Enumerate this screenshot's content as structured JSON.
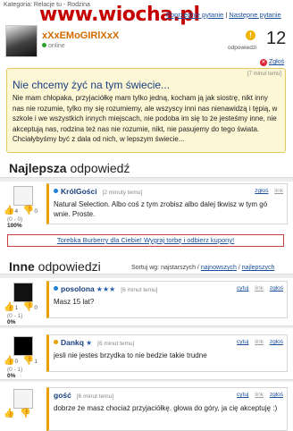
{
  "topbar": {
    "category_text": "Kategoria: Relacje tu - Rodzina",
    "watermark": "www.wiocha.pl",
    "prev_question": "Poprzednie pytanie",
    "separator": "|",
    "next_question": "Następne pytanie"
  },
  "asker": {
    "username": "xXxEMoGIRlXxX",
    "status": "online",
    "answers_count": "12",
    "answers_label": "odpowiedzi",
    "report_label": "Zgłoś"
  },
  "question": {
    "time": "[7 minut temu]",
    "title": "Nie chcemy żyć na tym świecie...",
    "body": "Nie mam chłopaka, przyjaciółkę mam tylko jedną, kocham ją jak siostrę, nikt inny nas nie rozumie, tylko my się rozumiemy, ale wszyscy inni nas nienawidzą i tępią, w szkole i we wszystkich innych miejscach, nie podoba im się to że jesteśmy inne, nie akceptują nas, rodzina też nas nie rozumie, nikt, nie pasujemy do tego świata. Chciałybyśmy być z dala od nich, w lepszym świecie..."
  },
  "best": {
    "title_bold": "Najlepsza",
    "title_rest": "odpowiedź",
    "author": "KrólGości",
    "time": "[2 minuty temu]",
    "report": "zgłoś",
    "link": "link",
    "text": "Natural Selection. Albo coś z tym zrobisz albo dalej tkwisz w tym gó wnie. Proste.",
    "votes_up": "4",
    "votes_down": "0",
    "tally": "(0 - 0)",
    "percent": "100%"
  },
  "ad": {
    "text": "Torebka Burberry dla Ciebie! Wygraj torbę i odbierz kupony!"
  },
  "others": {
    "title_bold": "Inne",
    "title_rest": "odpowiedzi",
    "sort_label": "Sortuj wg: najstarszych /",
    "sort_newest": "najnowszych",
    "sort_sep": "/",
    "sort_best": "najlepszych",
    "answers": [
      {
        "author": "posolona",
        "stars": "★★★",
        "time": "[6 minut temu]",
        "quote": "cytuj",
        "report": "link",
        "link": "zgłoś",
        "text": "Masz 15 lat?",
        "votes_up": "1",
        "votes_down": "0",
        "tally": "(0 - 1)",
        "percent": "0%"
      },
      {
        "author": "Dankq",
        "stars": "★",
        "time": "[6 minut temu]",
        "quote": "cytuj",
        "report": "link",
        "link": "zgłoś",
        "text": "jesli nie jestes brzydka to nie bedzie takie trudne",
        "votes_up": "0",
        "votes_down": "1",
        "tally": "(0 - 1)",
        "percent": "0%"
      },
      {
        "author": "gość",
        "stars": "",
        "time": "[6 minut temu]",
        "quote": "cytuj",
        "report": "link",
        "link": "zgłoś",
        "text": "dobrze że masz chociaż przyjaciółkę.  głowa do góry, ja cię akceptuję :)",
        "votes_up": "",
        "votes_down": "",
        "tally": "",
        "percent": ""
      }
    ]
  },
  "colors": {
    "question_bg": "#fdf7d6",
    "link": "#1a4f9c",
    "accent_orange": "#e8a000",
    "watermark_red": "#c40000"
  },
  "icons": {
    "thumb_up": "thumb-up-icon",
    "thumb_down": "thumb-down-icon",
    "online_dot": "online-dot-icon",
    "warning": "warning-icon",
    "report": "report-x-icon"
  }
}
